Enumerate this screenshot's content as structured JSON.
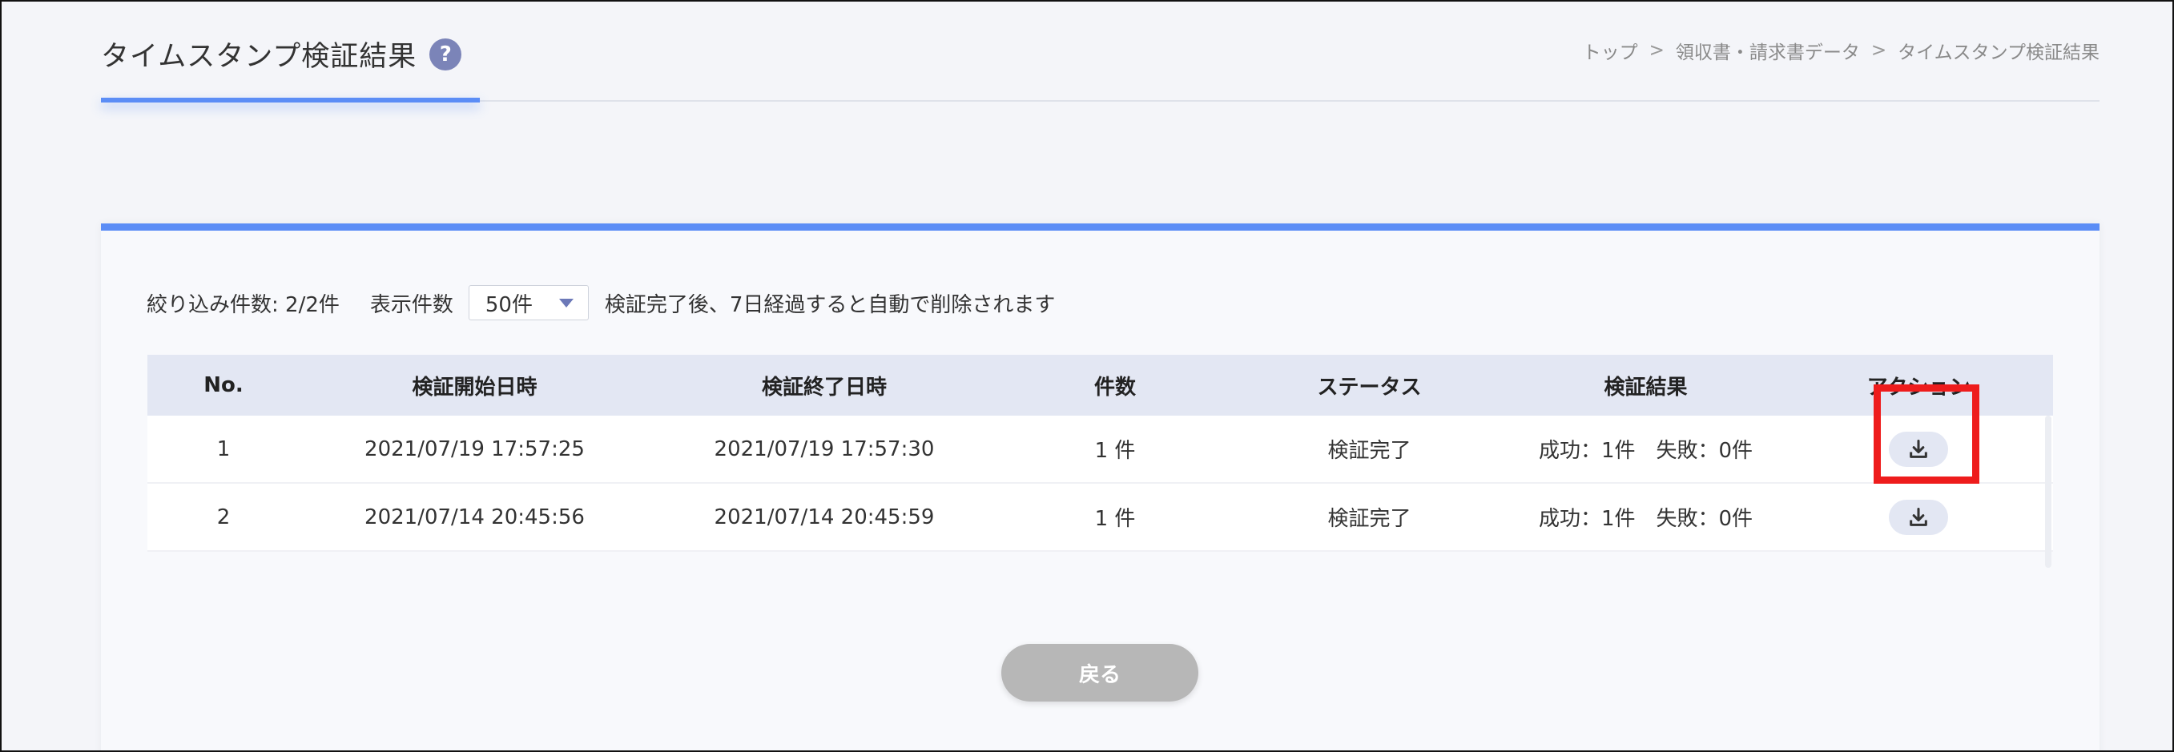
{
  "header": {
    "title": "タイムスタンプ検証結果",
    "help_icon": "?",
    "breadcrumb": [
      "トップ",
      "領収書・請求書データ",
      "タイムスタンプ検証結果"
    ],
    "breadcrumb_separator": ">"
  },
  "filter": {
    "count_text": "絞り込み件数: 2/2件",
    "display_label": "表示件数",
    "display_value": "50件",
    "notice": "検証完了後、7日経過すると自動で削除されます"
  },
  "table": {
    "headers": {
      "no": "No.",
      "start": "検証開始日時",
      "end": "検証終了日時",
      "count": "件数",
      "status": "ステータス",
      "result": "検証結果",
      "action": "アクション"
    },
    "rows": [
      {
        "no": "1",
        "start": "2021/07/19 17:57:25",
        "end": "2021/07/19 17:57:30",
        "count": "1 件",
        "status": "検証完了",
        "result": "成功：1件　失敗：0件",
        "action_icon": "download-icon"
      },
      {
        "no": "2",
        "start": "2021/07/14 20:45:56",
        "end": "2021/07/14 20:45:59",
        "count": "1 件",
        "status": "検証完了",
        "result": "成功：1件　失敗：0件",
        "action_icon": "download-icon"
      }
    ]
  },
  "back_button": "戻る",
  "colors": {
    "accent_blue": "#5b8df6",
    "highlight_red": "#ee1c1c",
    "back_button_gray": "#b7b7b7",
    "table_header_bg": "#e3e7f3"
  }
}
